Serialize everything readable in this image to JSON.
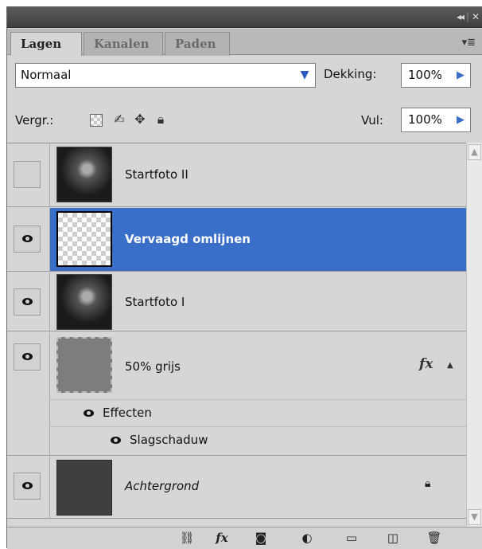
{
  "tabs": [
    {
      "label": "Lagen",
      "active": true
    },
    {
      "label": "Kanalen",
      "active": false
    },
    {
      "label": "Paden",
      "active": false
    }
  ],
  "window_controls": {
    "collapse": "◂◂",
    "separator": "|",
    "close": "✕",
    "menu": "▾≣"
  },
  "blend": {
    "mode": "Normaal"
  },
  "opacity": {
    "label": "Dekking:",
    "value": "100%"
  },
  "lock": {
    "label": "Vergr.:",
    "icons": [
      "lock-transparency-icon",
      "brush-icon",
      "move-icon",
      "lock-icon"
    ]
  },
  "fill": {
    "label": "Vul:",
    "value": "100%"
  },
  "layers": [
    {
      "name": "Startfoto II",
      "visible": false,
      "thumb": "photo",
      "selected": false
    },
    {
      "name": "Vervaagd omlijnen",
      "visible": true,
      "thumb": "transparent",
      "selected": true
    },
    {
      "name": "Startfoto I",
      "visible": true,
      "thumb": "photo",
      "selected": false
    },
    {
      "name": "50% grijs",
      "visible": true,
      "thumb": "grey",
      "selected": false,
      "fx": "fx",
      "effects": {
        "label": "Effecten",
        "items": [
          "Slagschaduw"
        ]
      }
    },
    {
      "name": "Achtergrond",
      "visible": true,
      "thumb": "dark",
      "selected": false,
      "locked": true
    }
  ],
  "bottom_icons": [
    "link-icon",
    "fx-icon",
    "mask-icon",
    "adjustment-icon",
    "folder-icon",
    "new-layer-icon",
    "trash-icon"
  ],
  "colors": {
    "selection": "#3a6fc9",
    "panel": "#d6d6d6",
    "titlebar": "#4a4a4a"
  }
}
